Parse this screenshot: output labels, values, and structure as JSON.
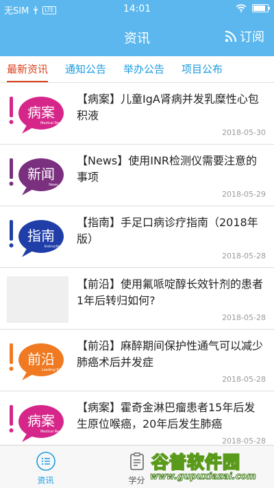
{
  "status_bar": {
    "carrier": "无SIM",
    "network": "lte",
    "time": "14:01",
    "battery_level": 0.85
  },
  "header": {
    "title": "资讯",
    "subscribe_label": "订阅"
  },
  "tabs": [
    {
      "label": "最新资讯",
      "active": true
    },
    {
      "label": "通知公告",
      "active": false
    },
    {
      "label": "举办公告",
      "active": false
    },
    {
      "label": "项目公布",
      "active": false
    }
  ],
  "colors": {
    "brand_blue": "#5bb7ee",
    "active_tab": "#d9401b",
    "tab_link": "#1a9be0"
  },
  "news": [
    {
      "title": "【病案】儿童IgA肾病并发乳糜性心包积液",
      "date": "2018-05-30",
      "thumb": {
        "char": "病案",
        "sub": "Medical Record",
        "color": "#d6268a"
      }
    },
    {
      "title": "【News】使用INR检测仪需要注意的事项",
      "date": "2018-05-29",
      "thumb": {
        "char": "新闻",
        "sub": "News",
        "color": "#7b2f7f"
      }
    },
    {
      "title": "【指南】手足口病诊疗指南（2018年版）",
      "date": "2018-05-28",
      "thumb": {
        "char": "指南",
        "sub": "Instruction",
        "color": "#1f3ea8"
      }
    },
    {
      "title": "【前沿】使用氟哌啶醇长效针剂的患者1年后转归如何?",
      "date": "2018-05-28",
      "thumb": null
    },
    {
      "title": "【前沿】麻醉期间保护性通气可以减少肺癌术后并发症",
      "date": "2018-05-28",
      "thumb": {
        "char": "前沿",
        "sub": "Leading Edge",
        "color": "#ef7a22"
      }
    },
    {
      "title": "【病案】霍奇金淋巴瘤患者15年后发生原位喉癌，20年后发生肺癌",
      "date": "2018-05-28",
      "thumb": {
        "char": "病案",
        "sub": "Medical Record",
        "color": "#d6268a"
      }
    }
  ],
  "tabbar": [
    {
      "label": "资讯",
      "icon": "list-icon",
      "active": true
    },
    {
      "label": "学分",
      "icon": "clipboard-icon",
      "active": false
    }
  ],
  "watermark": {
    "main": "谷普软件园",
    "url": "www.gupuxiazai.com"
  }
}
